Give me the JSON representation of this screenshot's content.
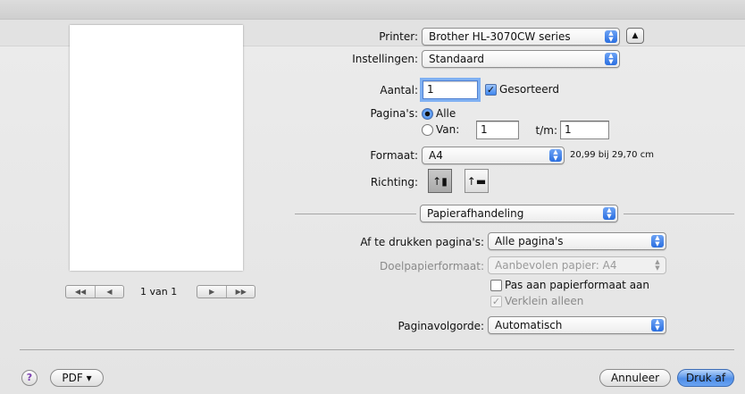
{
  "printer": {
    "label": "Printer:",
    "value": "Brother HL-3070CW series",
    "disclosure_icon": "triangle-up"
  },
  "presets": {
    "label": "Instellingen:",
    "value": "Standaard"
  },
  "copies": {
    "label": "Aantal:",
    "value": "1",
    "collated_label": "Gesorteerd",
    "collated": true
  },
  "pages": {
    "label": "Pagina's:",
    "all_label": "Alle",
    "from_label": "Van:",
    "from_value": "1",
    "to_label": "t/m:",
    "to_value": "1",
    "selected": "all"
  },
  "paper_size": {
    "label": "Formaat:",
    "value": "A4",
    "dimensions": "20,99 bij 29,70 cm"
  },
  "orientation": {
    "label": "Richting:",
    "selected": "portrait"
  },
  "section": {
    "value": "Papierafhandeling"
  },
  "paper_handling": {
    "pages_to_print_label": "Af te drukken pagina's:",
    "pages_to_print_value": "Alle pagina's",
    "destination_label": "Doelpapierformaat:",
    "destination_value": "Aanbevolen papier: A4",
    "scale_label": "Pas aan papierformaat aan",
    "scale_checked": false,
    "scale_down_label": "Verklein alleen",
    "scale_down_checked": true,
    "order_label": "Paginavolgorde:",
    "order_value": "Automatisch"
  },
  "preview": {
    "page_indicator": "1 van 1"
  },
  "footer": {
    "help": "?",
    "pdf_label": "PDF ▾",
    "cancel_label": "Annuleer",
    "print_label": "Druk af"
  },
  "colors": {
    "accent": "#3e86ee",
    "dim_text": "#8a8a8a"
  }
}
